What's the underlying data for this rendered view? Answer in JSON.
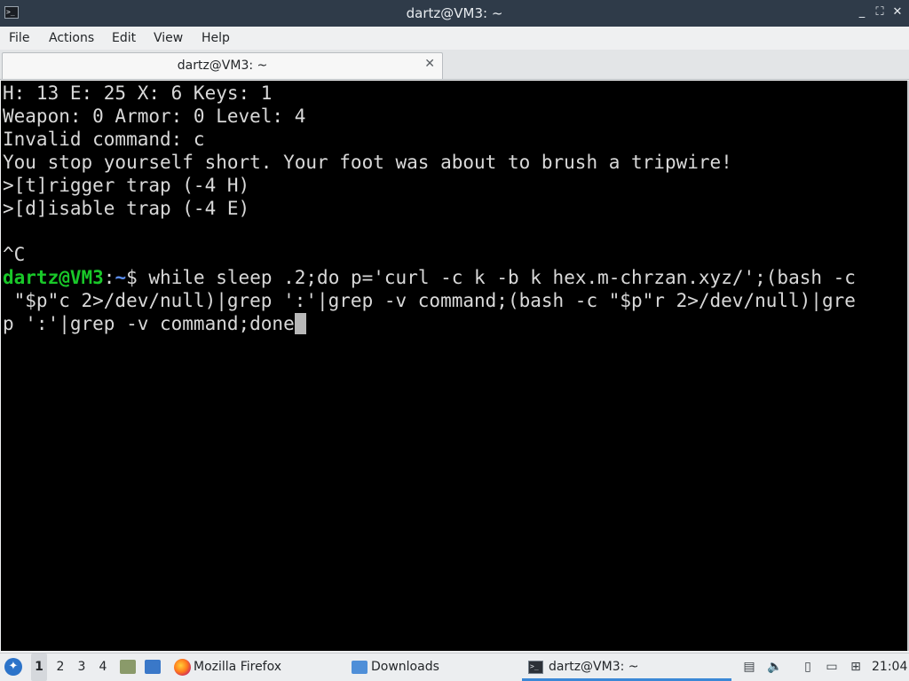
{
  "window": {
    "title": "dartz@VM3: ~",
    "minimize_glyph": "_",
    "maximize_glyph": "⛶",
    "close_glyph": "✕"
  },
  "menu": [
    "File",
    "Actions",
    "Edit",
    "View",
    "Help"
  ],
  "tab": {
    "label": "dartz@VM3: ~",
    "close_glyph": "✕"
  },
  "terminal": {
    "lines": [
      "H: 13 E: 25 X: 6 Keys: 1",
      "Weapon: 0 Armor: 0 Level: 4",
      "Invalid command: c",
      "You stop yourself short. Your foot was about to brush a tripwire!",
      ">[t]rigger trap (-4 H)",
      ">[d]isable trap (-4 E)",
      "",
      "^C"
    ],
    "prompt": {
      "user": "dartz@VM3",
      "colon": ":",
      "path": "~",
      "dollar": "$"
    },
    "command_lines": [
      " while sleep .2;do p='curl -c k -b k hex.m-chrzan.xyz/';(bash -c",
      " \"$p\"c 2>/dev/null)|grep ':'|grep -v command;(bash -c \"$p\"r 2>/dev/null)|gre",
      "p ':'|grep -v command;done"
    ]
  },
  "taskbar": {
    "desktops": [
      "1",
      "2",
      "3",
      "4"
    ],
    "active_desktop": "1",
    "tasks": [
      {
        "label": "Mozilla Firefox",
        "icon": "firefox-icon"
      },
      {
        "label": "Downloads",
        "icon": "folder-icon"
      },
      {
        "label": "dartz@VM3: ~",
        "icon": "terminal-icon",
        "active": true
      }
    ],
    "clock": "21:04",
    "accent": "#3b88d6"
  },
  "colors": {
    "titlebar": "#2f3b49",
    "terminal_bg": "#000000",
    "prompt_user": "#19c829",
    "prompt_path": "#5b8def"
  }
}
